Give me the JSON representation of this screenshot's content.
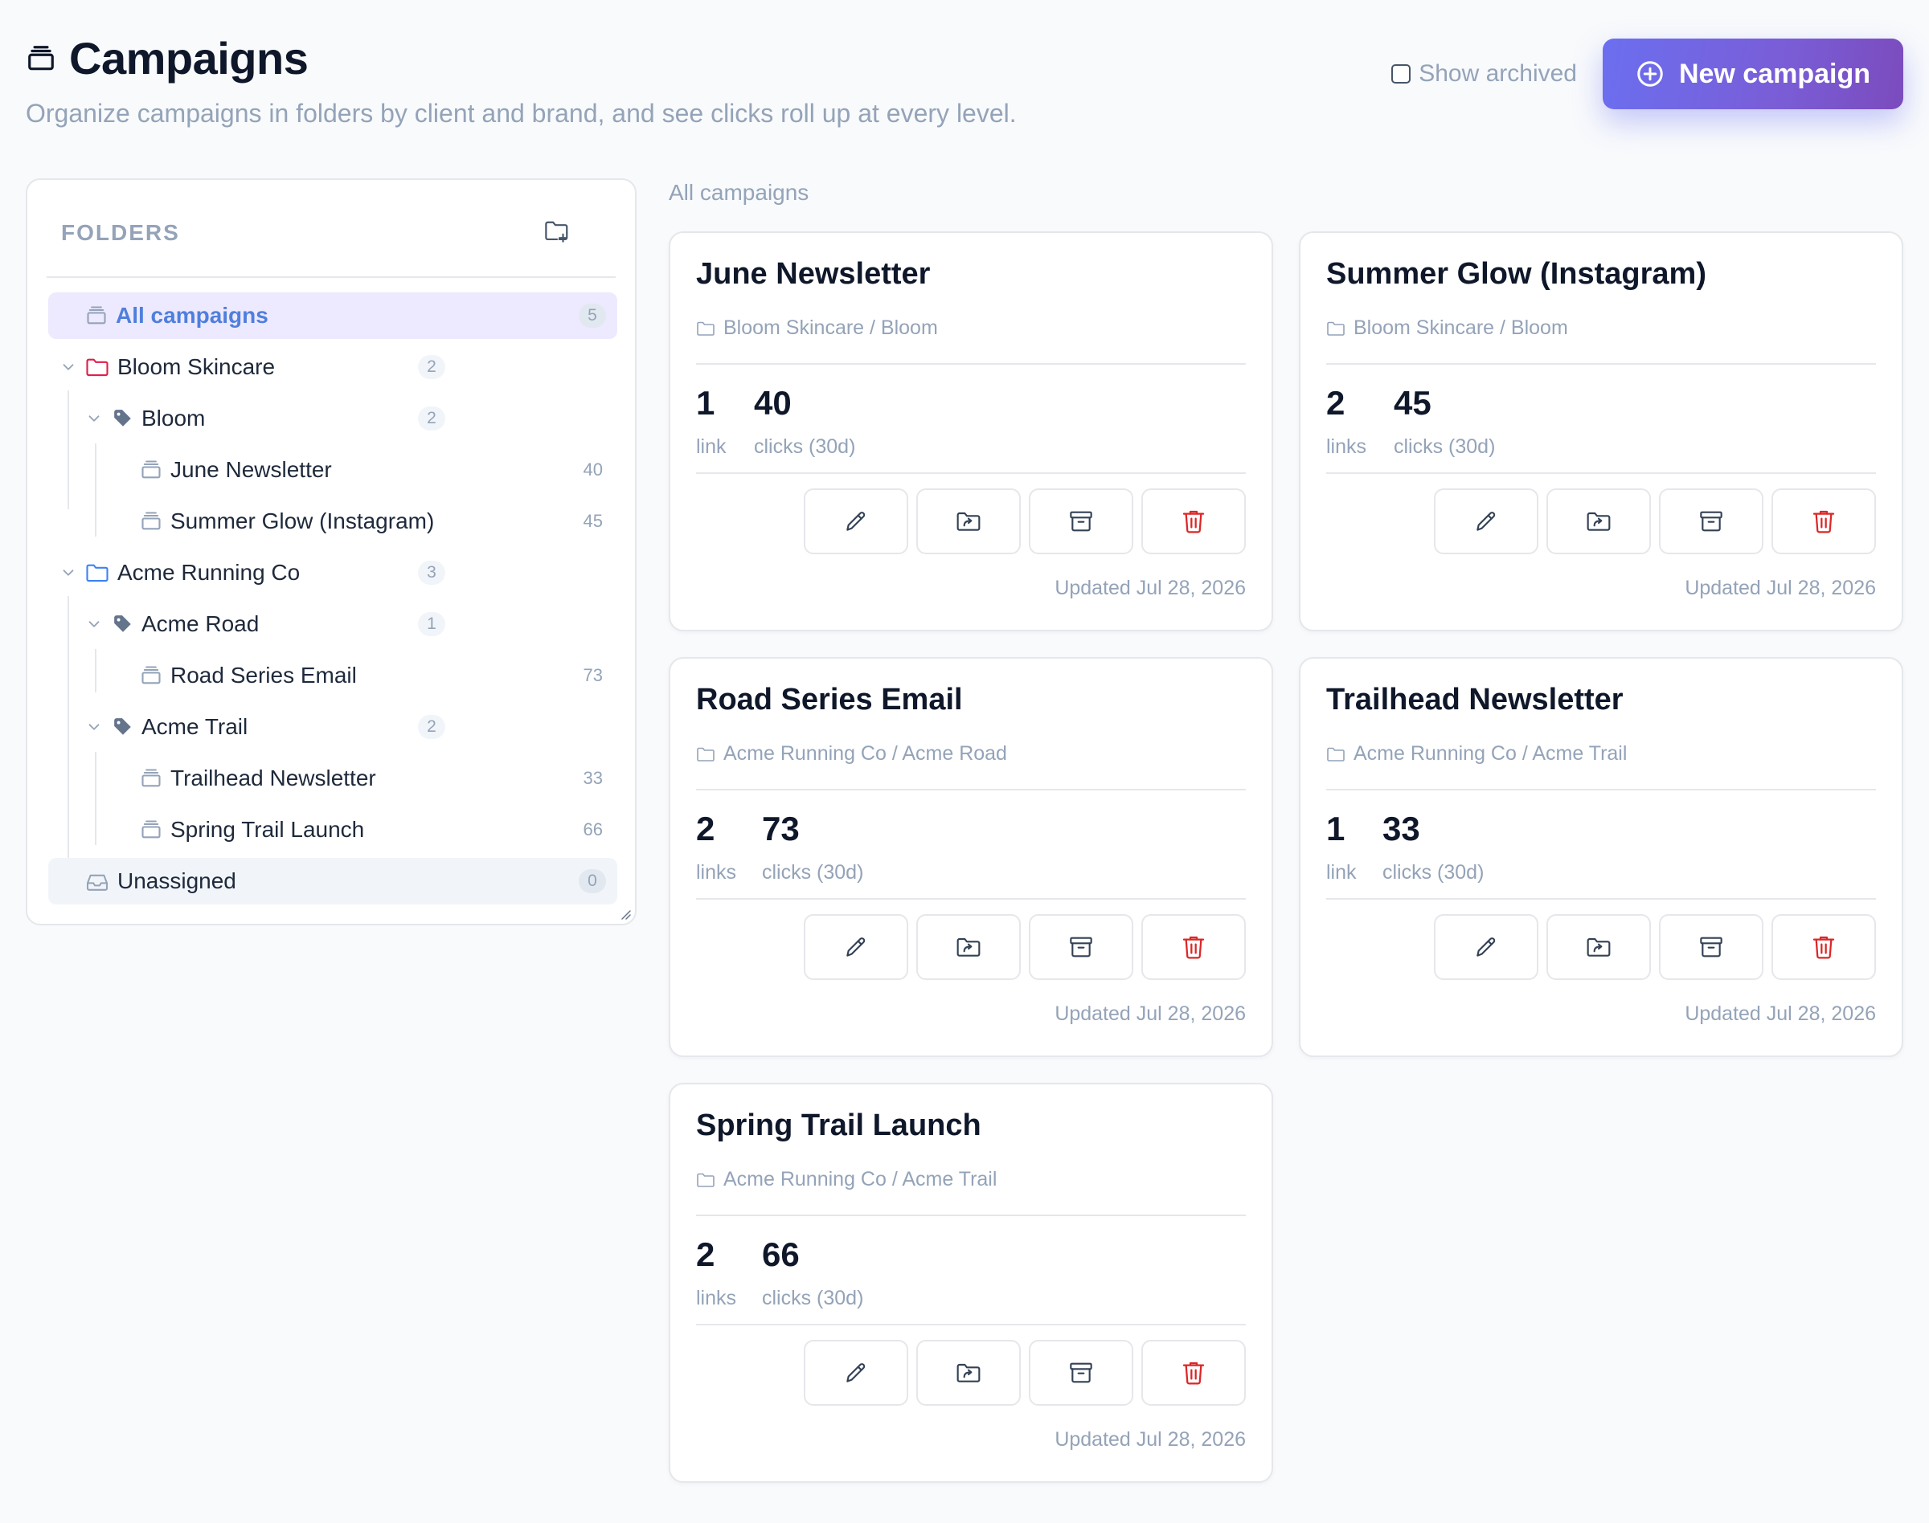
{
  "header": {
    "title": "Campaigns",
    "subtitle": "Organize campaigns in folders by client and brand, and see clicks roll up at every level.",
    "show_archived_label": "Show archived",
    "new_campaign_label": "New campaign"
  },
  "sidebar": {
    "title": "FOLDERS",
    "all": {
      "label": "All campaigns",
      "count": "5"
    },
    "clients": [
      {
        "label": "Bloom Skincare",
        "count": "2",
        "color": "#e11d48",
        "brands": [
          {
            "label": "Bloom",
            "count": "2",
            "campaigns": [
              {
                "label": "June Newsletter",
                "count": "40"
              },
              {
                "label": "Summer Glow (Instagram)",
                "count": "45"
              }
            ]
          }
        ]
      },
      {
        "label": "Acme Running Co",
        "count": "3",
        "color": "#3b82f6",
        "brands": [
          {
            "label": "Acme Road",
            "count": "1",
            "campaigns": [
              {
                "label": "Road Series Email",
                "count": "73"
              }
            ]
          },
          {
            "label": "Acme Trail",
            "count": "2",
            "campaigns": [
              {
                "label": "Trailhead Newsletter",
                "count": "33"
              },
              {
                "label": "Spring Trail Launch",
                "count": "66"
              }
            ]
          }
        ]
      }
    ],
    "unassigned": {
      "label": "Unassigned",
      "count": "0"
    }
  },
  "main": {
    "section_label": "All campaigns",
    "cards": [
      {
        "title": "June Newsletter",
        "path": "Bloom Skincare / Bloom",
        "links": "1",
        "links_label": "link",
        "clicks": "40",
        "clicks_label": "clicks (30d)",
        "updated": "Updated Jul 28, 2026"
      },
      {
        "title": "Summer Glow (Instagram)",
        "path": "Bloom Skincare / Bloom",
        "links": "2",
        "links_label": "links",
        "clicks": "45",
        "clicks_label": "clicks (30d)",
        "updated": "Updated Jul 28, 2026"
      },
      {
        "title": "Road Series Email",
        "path": "Acme Running Co / Acme Road",
        "links": "2",
        "links_label": "links",
        "clicks": "73",
        "clicks_label": "clicks (30d)",
        "updated": "Updated Jul 28, 2026"
      },
      {
        "title": "Trailhead Newsletter",
        "path": "Acme Running Co / Acme Trail",
        "links": "1",
        "links_label": "link",
        "clicks": "33",
        "clicks_label": "clicks (30d)",
        "updated": "Updated Jul 28, 2026"
      },
      {
        "title": "Spring Trail Launch",
        "path": "Acme Running Co / Acme Trail",
        "links": "2",
        "links_label": "links",
        "clicks": "66",
        "clicks_label": "clicks (30d)",
        "updated": "Updated Jul 28, 2026"
      }
    ]
  },
  "colors": {
    "accent": "#6b6ff0",
    "accent_text": "#4f7fdc",
    "danger": "#dc2626",
    "muted": "#94a3b8"
  }
}
